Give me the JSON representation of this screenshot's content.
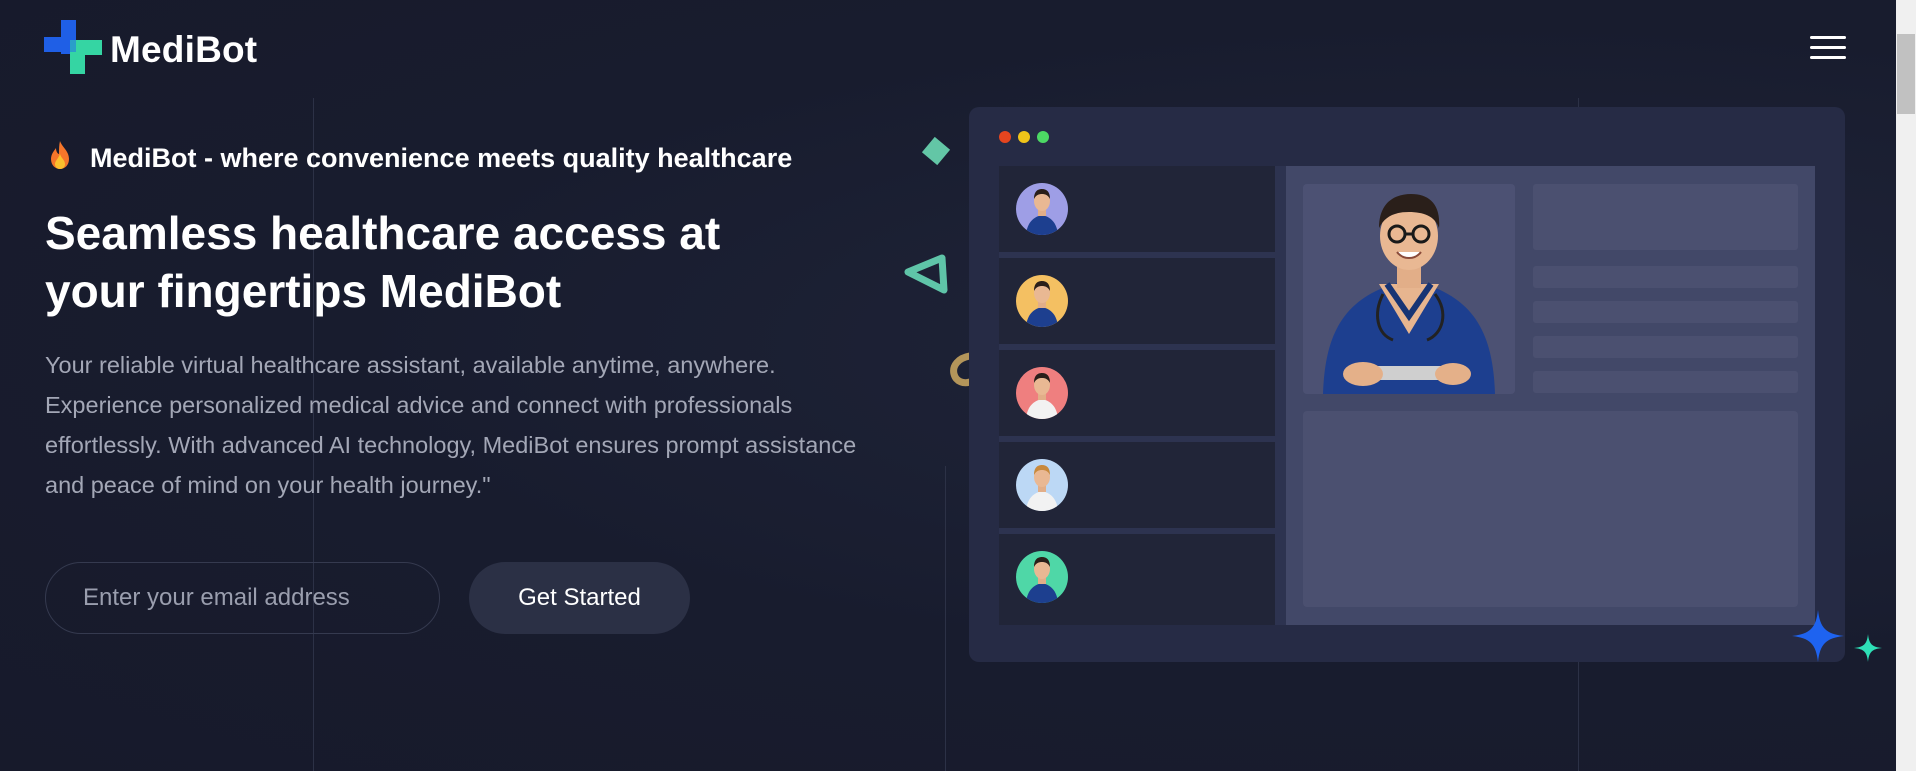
{
  "header": {
    "brand": "MediBot",
    "icons": {
      "logo": "medical-cross-logo",
      "menu": "hamburger-menu-icon"
    }
  },
  "hero": {
    "tagline_icon": "flame-icon",
    "tagline": "MediBot - where convenience meets quality healthcare",
    "title_line1": "Seamless healthcare access at",
    "title_line2": "your fingertips MediBot",
    "description": "Your reliable virtual healthcare assistant, available anytime, anywhere. Experience personalized medical advice and connect with professionals effortlessly. With advanced AI technology, MediBot ensures prompt assistance and peace of mind on your health journey.\"",
    "email_placeholder": "Enter your email address",
    "cta_label": "Get Started"
  },
  "mockup": {
    "window_dots": [
      "#e5451f",
      "#f0c419",
      "#4cd964"
    ],
    "doctors": [
      {
        "avatar_bg": "#9e9ee6",
        "icon": "doctor-avatar-icon"
      },
      {
        "avatar_bg": "#f4c062",
        "icon": "doctor-avatar-icon"
      },
      {
        "avatar_bg": "#ef7f7f",
        "icon": "doctor-avatar-icon"
      },
      {
        "avatar_bg": "#bcd8f5",
        "icon": "doctor-avatar-icon"
      },
      {
        "avatar_bg": "#4fd7a7",
        "icon": "doctor-avatar-icon"
      }
    ],
    "featured_icon": "doctor-photo"
  },
  "colors": {
    "background": "#181c2e",
    "accent_blue": "#1e63f0",
    "accent_teal": "#2ee0b7",
    "button_bg": "#2b3045"
  }
}
